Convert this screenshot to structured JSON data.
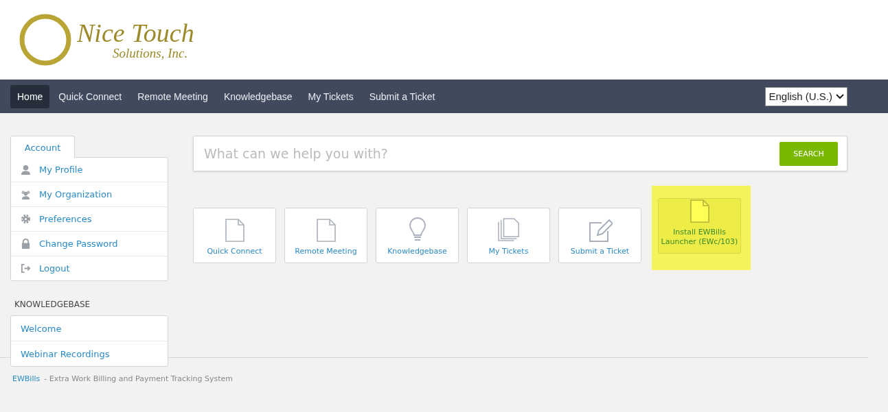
{
  "logo": {
    "title": "Nice Touch",
    "subtitle": "Solutions, Inc."
  },
  "nav": {
    "items": [
      {
        "label": "Home",
        "selected": true
      },
      {
        "label": "Quick Connect",
        "selected": false
      },
      {
        "label": "Remote Meeting",
        "selected": false
      },
      {
        "label": "Knowledgebase",
        "selected": false
      },
      {
        "label": "My Tickets",
        "selected": false
      },
      {
        "label": "Submit a Ticket",
        "selected": false
      }
    ],
    "language": "English (U.S.)"
  },
  "sidebar": {
    "tab": "Account",
    "account_items": [
      {
        "label": "My Profile",
        "kind": "person"
      },
      {
        "label": "My Organization",
        "kind": "group"
      },
      {
        "label": "Preferences",
        "kind": "gear"
      },
      {
        "label": "Change Password",
        "kind": "lock"
      },
      {
        "label": "Logout",
        "kind": "logout"
      }
    ],
    "knowledgebase_heading": "KNOWLEDGEBASE",
    "knowledgebase_items": [
      "Welcome",
      "Webinar Recordings"
    ]
  },
  "search": {
    "placeholder": "What can we help you with?",
    "button": "SEARCH"
  },
  "tiles": [
    {
      "label": "Quick Connect",
      "kind": "file",
      "highlighted": false
    },
    {
      "label": "Remote Meeting",
      "kind": "file",
      "highlighted": false
    },
    {
      "label": "Knowledgebase",
      "kind": "bulb",
      "highlighted": false
    },
    {
      "label": "My Tickets",
      "kind": "files",
      "highlighted": false
    },
    {
      "label": "Submit a Ticket",
      "kind": "edit",
      "highlighted": false
    },
    {
      "label": "Install EWBills Launcher (EWc/103)",
      "kind": "file",
      "highlighted": true
    }
  ],
  "footer": {
    "link": "EWBills",
    "text": "- Extra Work Billing and Payment Tracking System"
  }
}
